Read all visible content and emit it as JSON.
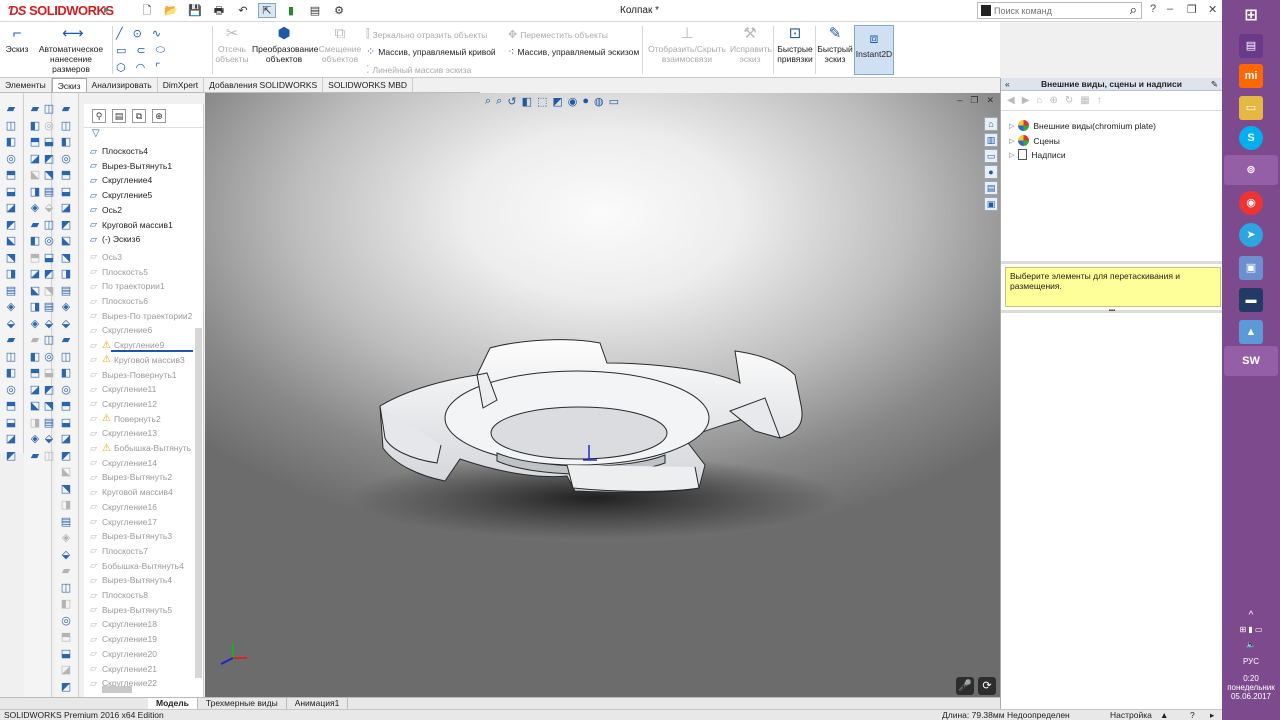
{
  "app": {
    "logo": "SOLIDWORKS",
    "title": "Колпак *",
    "search_placeholder": "Поиск команд"
  },
  "ribbon": {
    "sketch": "Эскиз",
    "smart_dim": "Автоматическое нанесение размеров",
    "trim": "Отсечь объекты",
    "convert": "Преобразование объектов",
    "offset": "Смещение объектов",
    "mirror": "Зеркально отразить объекты",
    "curve_pattern": "Массив, управляемый кривой",
    "linear_pattern": "Линейный массив эскиза",
    "move": "Переместить объекты",
    "sketch_pattern": "Массив, управляемый эскизом",
    "show_hide": "Отобразить/Скрыть взаимосвязи",
    "repair": "Исправить эскиз",
    "snaps": "Быстрые привязки",
    "rapid": "Быстрый эскиз",
    "instant2d": "Instant2D"
  },
  "tabs": [
    "Элементы",
    "Эскиз",
    "Анализировать",
    "DimXpert",
    "Добавления SOLIDWORKS",
    "SOLIDWORKS MBD"
  ],
  "tree": {
    "active": [
      {
        "label": "Плоскость4",
        "icon": "plane-icon"
      },
      {
        "label": "Вырез-Вытянуть1",
        "icon": "cut-extrude-icon"
      },
      {
        "label": "Скругление4",
        "icon": "fillet-icon"
      },
      {
        "label": "Скругление5",
        "icon": "fillet-icon"
      },
      {
        "label": "Ось2",
        "icon": "axis-icon"
      },
      {
        "label": "Круговой массив1",
        "icon": "circular-pattern-icon"
      },
      {
        "label": "(-) Эскиз6",
        "icon": "sketch-icon"
      }
    ],
    "suppressed": [
      {
        "label": "Ось3",
        "warn": false
      },
      {
        "label": "Плоскость5",
        "warn": false
      },
      {
        "label": "По траектории1",
        "warn": false
      },
      {
        "label": "Плоскость6",
        "warn": false
      },
      {
        "label": "Вырез-По траектории2",
        "warn": false
      },
      {
        "label": "Скругление6",
        "warn": false
      },
      {
        "label": "Скругление9",
        "warn": true
      },
      {
        "label": "Круговой массив3",
        "warn": true
      },
      {
        "label": "Вырез-Повернуть1",
        "warn": false
      },
      {
        "label": "Скругление11",
        "warn": false
      },
      {
        "label": "Скругление12",
        "warn": false
      },
      {
        "label": "Повернуть2",
        "warn": true
      },
      {
        "label": "Скругление13",
        "warn": false
      },
      {
        "label": "Бобышка-Вытянуть",
        "warn": true
      },
      {
        "label": "Скругление14",
        "warn": false
      },
      {
        "label": "Вырез-Вытянуть2",
        "warn": false
      },
      {
        "label": "Круговой массив4",
        "warn": false
      },
      {
        "label": "Скругление16",
        "warn": false
      },
      {
        "label": "Скругление17",
        "warn": false
      },
      {
        "label": "Вырез-Вытянуть3",
        "warn": false
      },
      {
        "label": "Плоскость7",
        "warn": false
      },
      {
        "label": "Бобышка-Вытянуть4",
        "warn": false
      },
      {
        "label": "Вырез-Вытянуть4",
        "warn": false
      },
      {
        "label": "Плоскость8",
        "warn": false
      },
      {
        "label": "Вырез-Вытянуть5",
        "warn": false
      },
      {
        "label": "Скругление18",
        "warn": false
      },
      {
        "label": "Скругление19",
        "warn": false
      },
      {
        "label": "Скругление20",
        "warn": false
      },
      {
        "label": "Скругление21",
        "warn": false
      },
      {
        "label": "Скругление22",
        "warn": false
      }
    ]
  },
  "doc_tabs": [
    "Модель",
    "Трехмерные виды",
    "Анимация1"
  ],
  "status": {
    "edition": "SOLIDWORKS Premium 2016 x64 Edition",
    "length": "Длина: 79.38мм",
    "state": "Недоопределен",
    "config": "Настройка"
  },
  "taskpane": {
    "title": "Внешние виды, сцены и надписи",
    "appearances": "Внешние виды(chromium plate)",
    "scenes": "Сцены",
    "decals": "Надписи",
    "note": "Выберите элементы для перетаскивания и размещения."
  },
  "taskbar": {
    "lang": "РУС",
    "time": "0:20",
    "day": "понедельник",
    "date": "05.06.2017"
  },
  "colors": {
    "brand": "#d02020",
    "taskbar": "#7d4a8e",
    "note_bg": "#ffff99",
    "accent": "#1d5aa3"
  }
}
